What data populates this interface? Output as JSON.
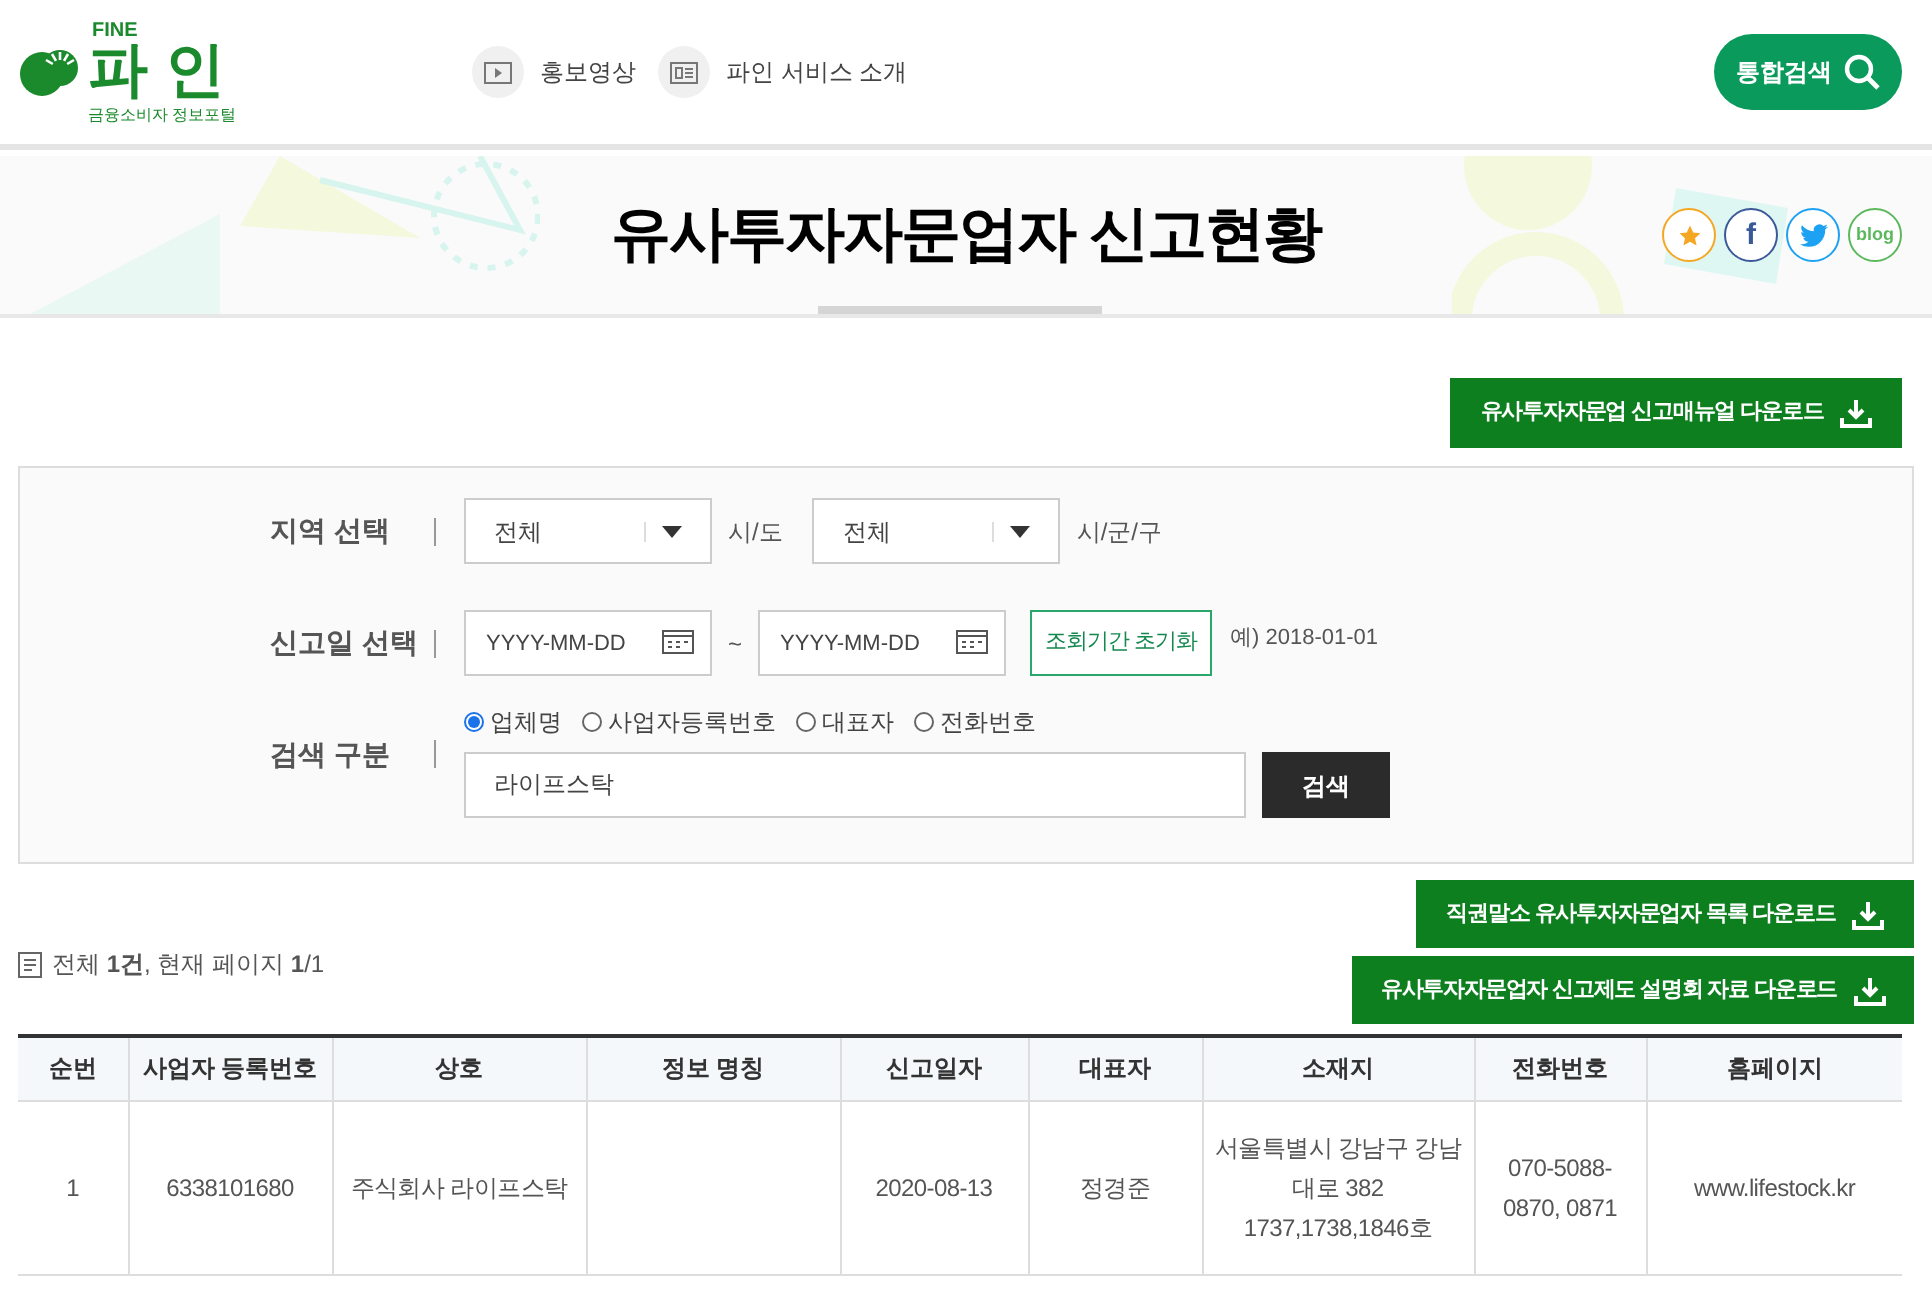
{
  "logo": {
    "top": "FINE",
    "name": "파 인",
    "subtitle": "금융소비자 정보포털"
  },
  "header_links": [
    {
      "kind": "video",
      "label": "홍보영상"
    },
    {
      "kind": "intro",
      "label": "파인 서비스 소개"
    }
  ],
  "search_button": "통합검색",
  "page_title": "유사투자자문업자 신고현황",
  "share_buttons": [
    {
      "kind": "star",
      "color": "#f5a623"
    },
    {
      "kind": "facebook",
      "label": "f",
      "color": "#3b5998"
    },
    {
      "kind": "twitter",
      "color": "#1da1f2"
    },
    {
      "kind": "blog",
      "label": "blog",
      "color": "#5cb85c"
    }
  ],
  "manual_download": "유사투자자문업 신고매뉴얼 다운로드",
  "filters": {
    "region": {
      "label": "지역 선택",
      "selects": [
        {
          "value": "전체",
          "suffix": "시/도"
        },
        {
          "value": "전체",
          "suffix": "시/군/구"
        }
      ]
    },
    "date": {
      "label": "신고일 선택",
      "from_placeholder": "YYYY-MM-DD",
      "separator": "~",
      "to_placeholder": "YYYY-MM-DD",
      "reset_button": "조회기간 초기화",
      "example": "예) 2018-01-01"
    },
    "search": {
      "label": "검색 구분",
      "options": [
        {
          "label": "업체명",
          "selected": true
        },
        {
          "label": "사업자등록번호",
          "selected": false
        },
        {
          "label": "대표자",
          "selected": false
        },
        {
          "label": "전화번호",
          "selected": false
        }
      ],
      "value": "라이프스탁",
      "button": "검색"
    }
  },
  "download_buttons": [
    "직권말소 유사투자자문업자 목록 다운로드",
    "유사투자자문업자 신고제도 설명회 자료 다운로드"
  ],
  "result_count": "전체 **1건**, 현재 페이지 **1**/1",
  "table": {
    "columns": [
      "순번",
      "사업자 등록번호",
      "상호",
      "정보 명칭",
      "신고일자",
      "대표자",
      "소재지",
      "전화번호",
      "홈페이지"
    ],
    "rows": [
      [
        "1",
        "6338101680",
        "주식회사 라이프스탁",
        "",
        "2020-08-13",
        "정경준",
        "서울특별시 강남구 강남대로 382 1737,1738,1846호",
        "070-5088-0870, 0871",
        "www.lifestock.kr"
      ]
    ]
  }
}
